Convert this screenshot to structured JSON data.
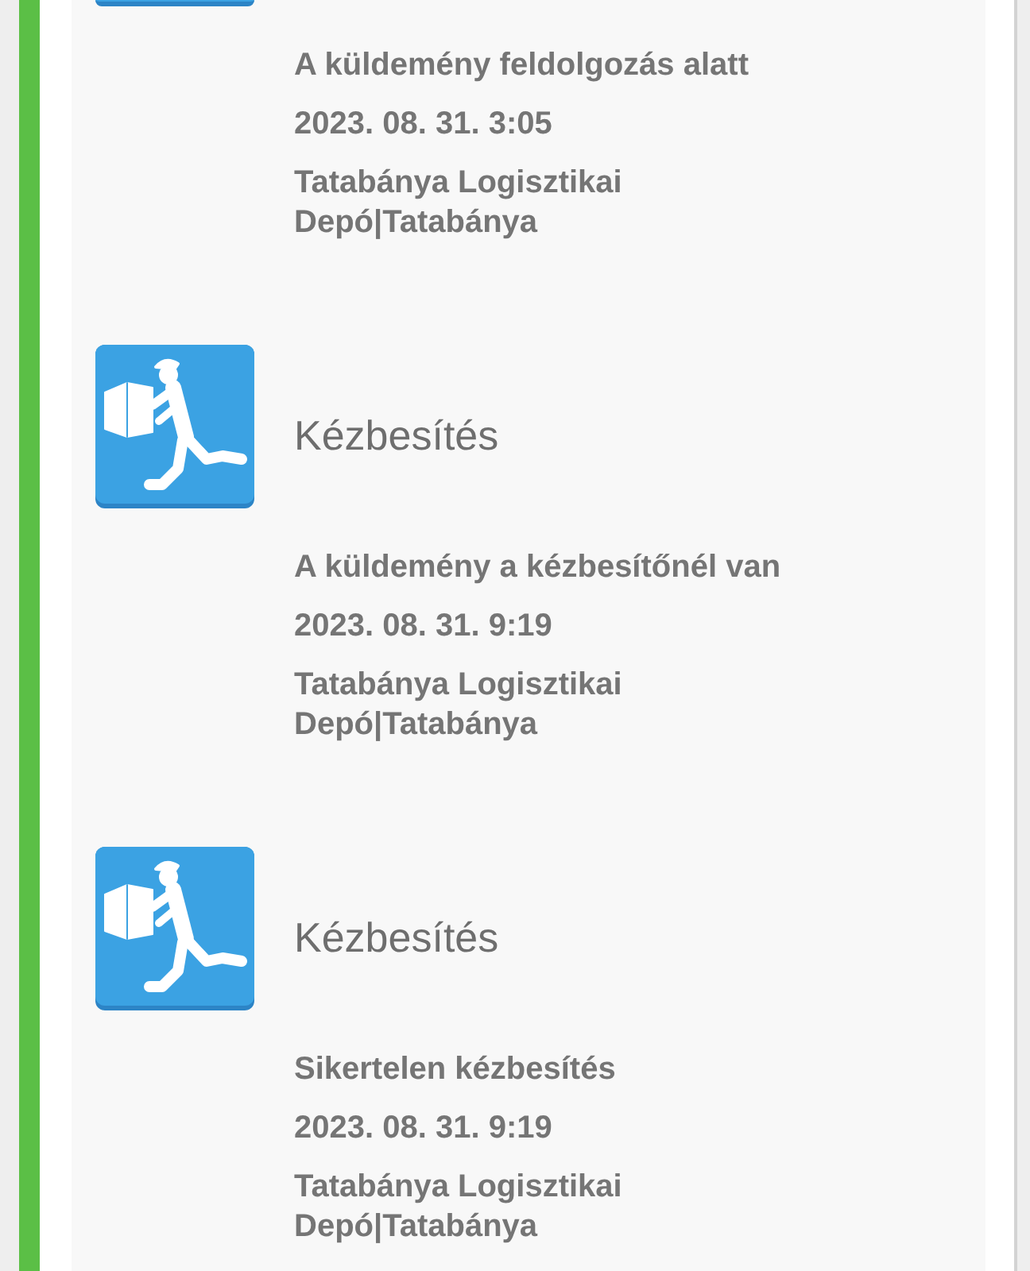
{
  "events": [
    {
      "description": "A küldemény feldolgozás alatt",
      "date": "2023. 08. 31. 3:05",
      "location": "Tatabánya Logisztikai Depó|Tatabánya"
    },
    {
      "title": "Kézbesítés",
      "description": "A küldemény a kézbesítőnél van",
      "date": "2023. 08. 31. 9:19",
      "location": "Tatabánya Logisztikai Depó|Tatabánya"
    },
    {
      "title": "Kézbesítés",
      "description": "Sikertelen kézbesítés",
      "date": "2023. 08. 31. 9:19",
      "location": "Tatabánya Logisztikai Depó|Tatabánya"
    }
  ]
}
